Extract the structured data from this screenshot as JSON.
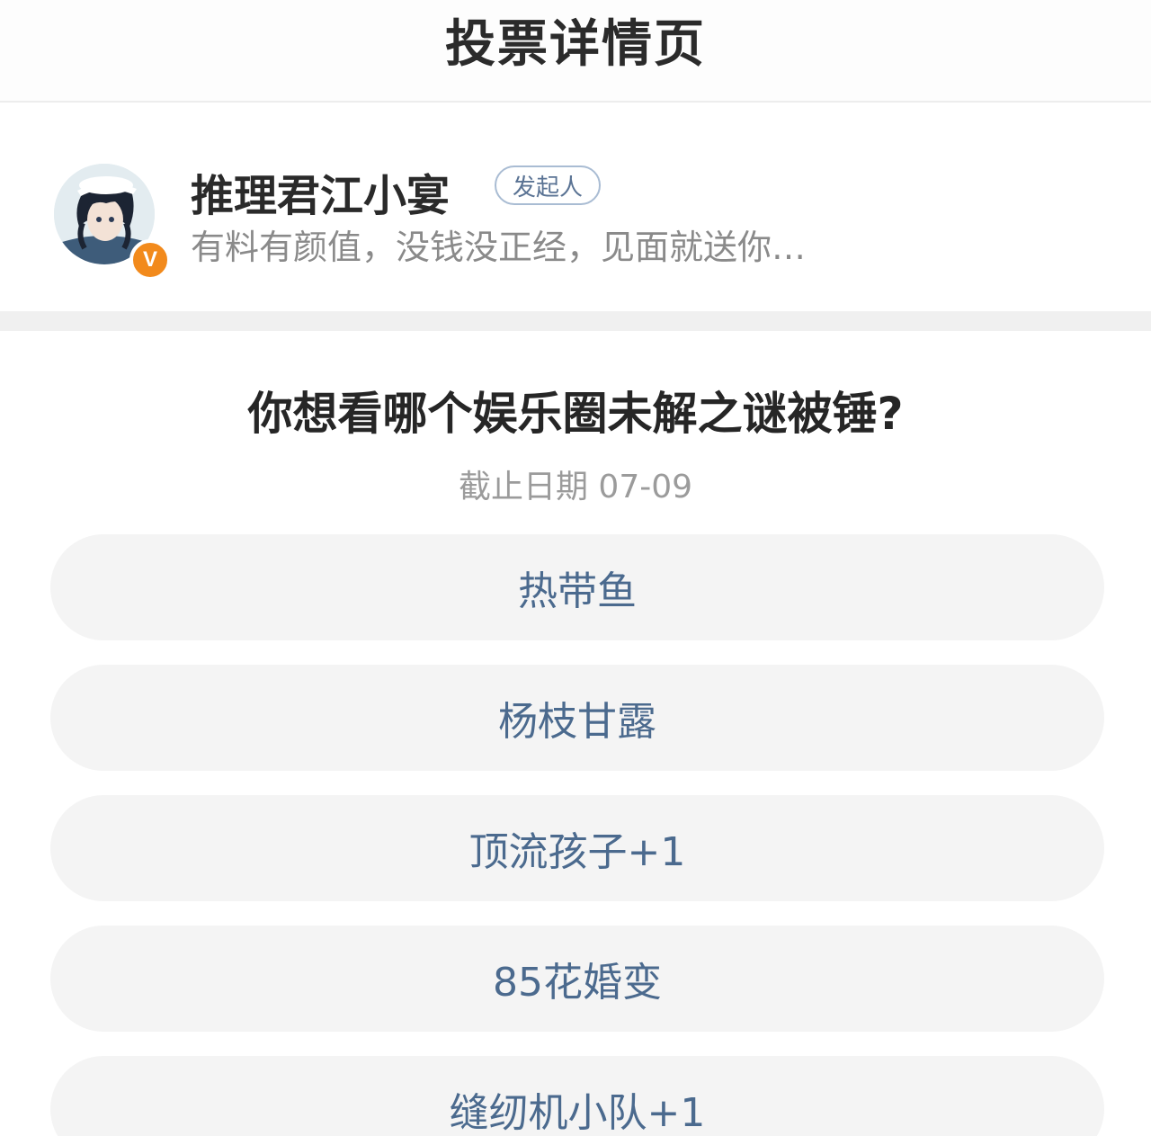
{
  "header": {
    "title": "投票详情页"
  },
  "author": {
    "name": "推理君江小宴",
    "role_tag": "发起人",
    "bio": "有料有颜值，没钱没正经，见面就送你…",
    "verified_mark": "V"
  },
  "poll": {
    "question": "你想看哪个娱乐圈未解之谜被锤?",
    "deadline": "截止日期 07-09",
    "options": [
      {
        "label": "热带鱼"
      },
      {
        "label": "杨枝甘露"
      },
      {
        "label": "顶流孩子+1"
      },
      {
        "label": "85花婚变"
      },
      {
        "label": "缝纫机小队+1"
      }
    ]
  },
  "colors": {
    "accent_text": "#4b6a8e",
    "option_background": "#f4f4f4",
    "verified_badge": "#f28a1c"
  },
  "icons": {
    "avatar": "avatar-portrait",
    "verified": "verified-icon"
  }
}
